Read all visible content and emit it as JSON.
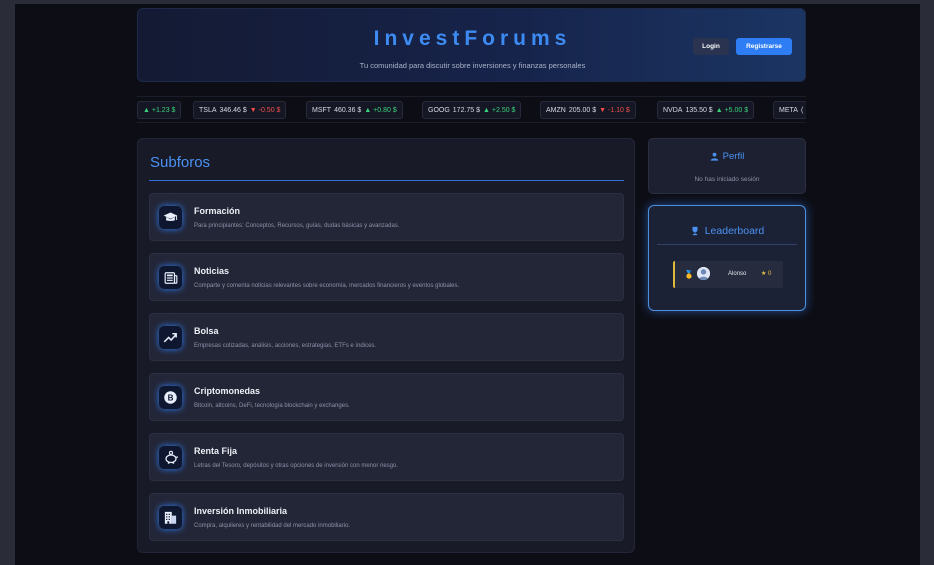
{
  "header": {
    "brand": "InvestForums",
    "tagline": "Tu comunidad para discutir sobre inversiones y finanzas personales",
    "login_label": "Login",
    "register_label": "Registrarse"
  },
  "ticker": [
    {
      "symbol": "",
      "price": "",
      "change": "▲ +1.23 $",
      "dir": "up"
    },
    {
      "symbol": "TSLA",
      "price": "346.46 $",
      "change": "▼ -0.50 $",
      "dir": "down"
    },
    {
      "symbol": "MSFT",
      "price": "460.36 $",
      "change": "▲ +0.80 $",
      "dir": "up"
    },
    {
      "symbol": "GOOG",
      "price": "172.75 $",
      "change": "▲ +2.50 $",
      "dir": "up"
    },
    {
      "symbol": "AMZN",
      "price": "205.00 $",
      "change": "▼ -1.10 $",
      "dir": "down"
    },
    {
      "symbol": "NVDA",
      "price": "135.50 $",
      "change": "▲ +5.00 $",
      "dir": "up"
    },
    {
      "symbol": "META",
      "price": "(",
      "change": "",
      "dir": "up"
    }
  ],
  "subforos": {
    "title": "Subforos",
    "items": [
      {
        "title": "Formación",
        "desc": "Para principiantes: Conceptos, Recursos, guías, dudas básicas y avanzadas.",
        "icon": "graduation-cap-icon"
      },
      {
        "title": "Noticias",
        "desc": "Comparte y comenta noticias relevantes sobre economía, mercados financieros y eventos globales.",
        "icon": "newspaper-icon"
      },
      {
        "title": "Bolsa",
        "desc": "Empresas cotizadas, análisis, acciones, estrategias, ETFs e índices.",
        "icon": "chart-trend-icon"
      },
      {
        "title": "Criptomonedas",
        "desc": "Bitcoin, altcoins, DeFi, tecnología blockchain y exchanges.",
        "icon": "bitcoin-icon"
      },
      {
        "title": "Renta Fija",
        "desc": "Letras del Tesoro, depósitos y otras opciones de inversión con menor riesgo.",
        "icon": "piggy-bank-icon"
      },
      {
        "title": "Inversión Inmobiliaria",
        "desc": "Compra, alquileres y rentabilidad del mercado inmobiliario.",
        "icon": "building-icon"
      }
    ]
  },
  "perfil": {
    "title": "Perfil",
    "status": "No has iniciado sesión"
  },
  "leaderboard": {
    "title": "Leaderboard",
    "entries": [
      {
        "medal": "🥇",
        "name": "Alonso",
        "score": "0"
      }
    ]
  },
  "colors": {
    "accent": "#2e7df4",
    "brand": "#3d8bf2",
    "up": "#3ad17b",
    "down": "#ef4c4c",
    "gold": "#e0b83a"
  }
}
